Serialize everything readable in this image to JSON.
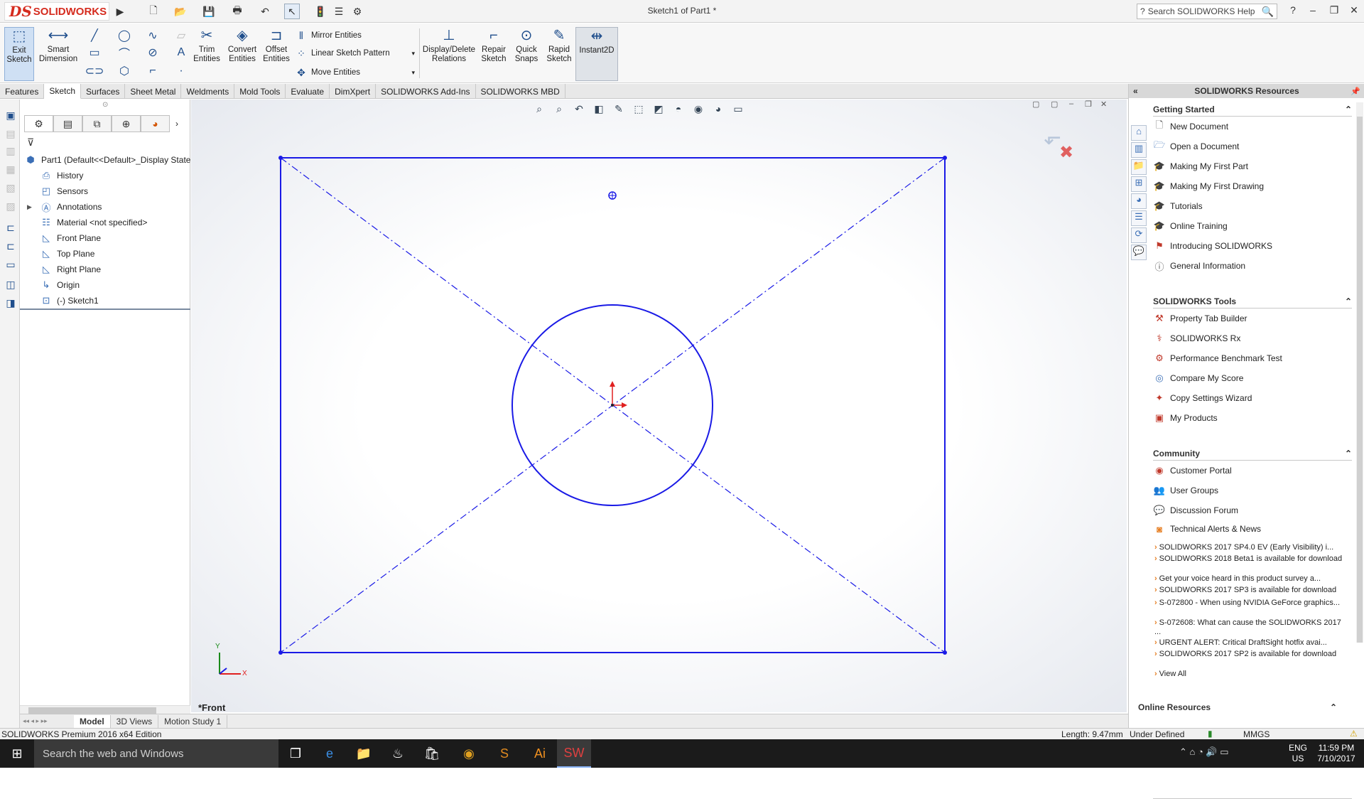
{
  "app": {
    "brand": "SOLIDWORKS",
    "ds": "DS",
    "title": "Sketch1 of Part1 *",
    "help_placeholder": "Search SOLIDWORKS Help"
  },
  "cmd": {
    "exit_sketch": "Exit Sketch",
    "smart_dimension": "Smart Dimension",
    "trim_entities": "Trim Entities",
    "convert_entities": "Convert Entities",
    "offset_entities": "Offset Entities",
    "mirror_entities": "Mirror Entities",
    "linear_pattern": "Linear Sketch Pattern",
    "move_entities": "Move Entities",
    "display_delete": "Display/Delete Relations",
    "repair_sketch": "Repair Sketch",
    "quick_snaps": "Quick Snaps",
    "rapid_sketch": "Rapid Sketch",
    "instant2d": "Instant2D"
  },
  "tabs": [
    "Features",
    "Sketch",
    "Surfaces",
    "Sheet Metal",
    "Weldments",
    "Mold Tools",
    "Evaluate",
    "DimXpert",
    "SOLIDWORKS Add-Ins",
    "SOLIDWORKS MBD"
  ],
  "tree": {
    "root": "Part1  (Default<<Default>_Display State",
    "items": [
      "History",
      "Sensors",
      "Annotations",
      "Material <not specified>",
      "Front Plane",
      "Top Plane",
      "Right Plane",
      "Origin",
      "(-) Sketch1"
    ]
  },
  "view_label": "*Front",
  "axis": {
    "x": "X",
    "y": "Y"
  },
  "model_tabs": [
    "Model",
    "3D Views",
    "Motion Study 1"
  ],
  "status": {
    "edition": "SOLIDWORKS Premium 2016 x64 Edition",
    "length": "Length: 9.47mm",
    "state": "Under Defined",
    "units": "MMGS"
  },
  "taskpane": {
    "title": "SOLIDWORKS Resources",
    "getting_started": {
      "title": "Getting Started",
      "items": [
        "New Document",
        "Open a Document",
        "Making My First Part",
        "Making My First Drawing",
        "Tutorials",
        "Online Training",
        "Introducing SOLIDWORKS",
        "General Information"
      ]
    },
    "tools": {
      "title": "SOLIDWORKS Tools",
      "items": [
        "Property Tab Builder",
        "SOLIDWORKS Rx",
        "Performance Benchmark Test",
        "Compare My Score",
        "Copy Settings Wizard",
        "My Products"
      ]
    },
    "community": {
      "title": "Community",
      "items": [
        "Customer Portal",
        "User Groups",
        "Discussion Forum",
        "Technical Alerts & News"
      ]
    },
    "news": [
      "SOLIDWORKS 2017 SP4.0 EV (Early Visibility) i...",
      "SOLIDWORKS 2018 Beta1 is available for download",
      "Get your voice heard in this product survey a...",
      "SOLIDWORKS 2017 SP3 is available for download",
      "S-072800 - When using NVIDIA GeForce graphics...",
      "S-072608: What can cause the SOLIDWORKS 2017 ...",
      "URGENT ALERT: Critical DraftSight hotfix avai...",
      "SOLIDWORKS 2017 SP2 is available for download"
    ],
    "view_all": "View All",
    "online_resources": "Online Resources"
  },
  "taskbar": {
    "search": "Search the web and Windows",
    "lang": "ENG",
    "region": "US",
    "time": "11:59 PM",
    "date": "7/10/2017"
  },
  "colors": {
    "sketch": "#1a1ae6",
    "accent": "#d52b1e",
    "selected_tab": "#ffffff"
  }
}
